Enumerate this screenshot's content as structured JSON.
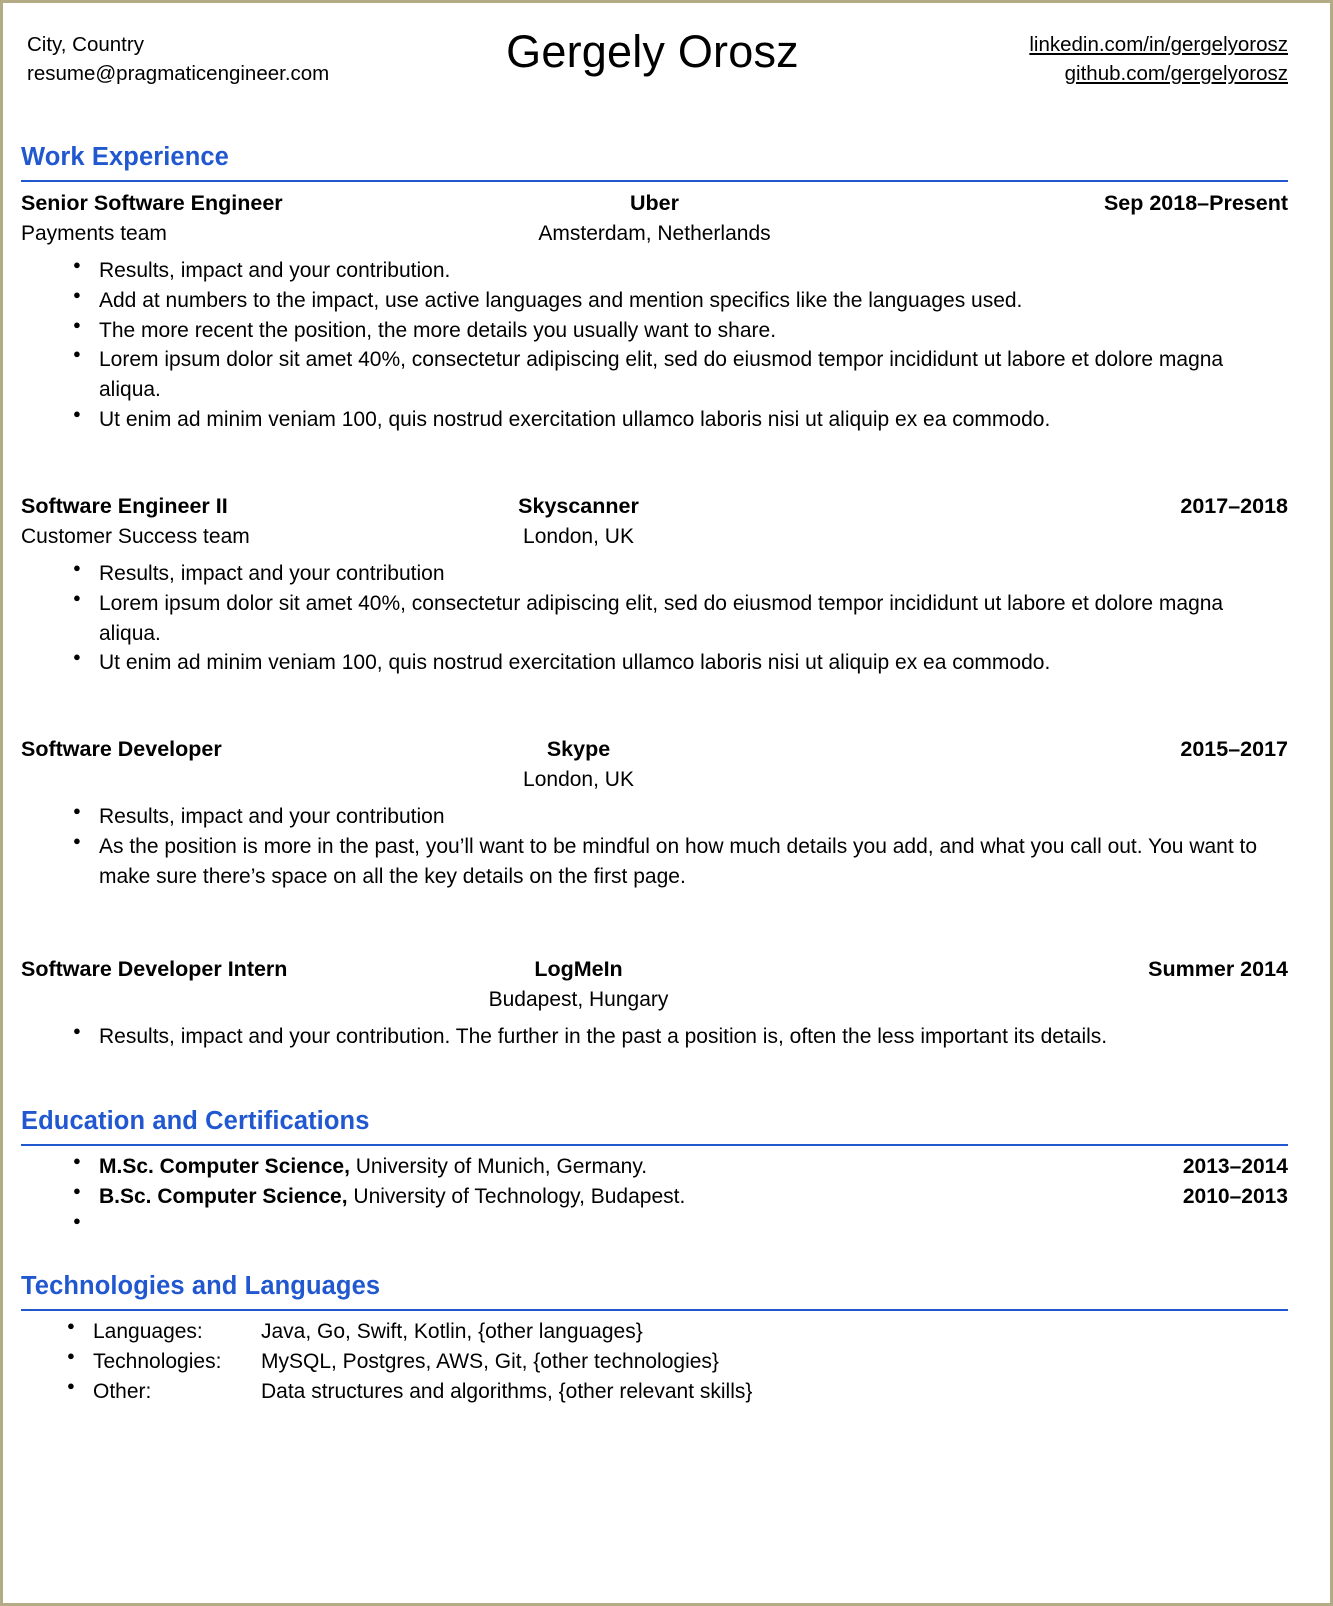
{
  "header": {
    "contact": {
      "location": "City, Country",
      "email": "resume@pragmaticengineer.com"
    },
    "name": "Gergely Orosz",
    "links": {
      "linkedin": "linkedin.com/in/gergelyorosz",
      "github": "github.com/gergelyorosz"
    }
  },
  "theme": {
    "accent": "#2158d0",
    "text": "#000000",
    "page_border": "#b3ab86"
  },
  "sections": {
    "work": {
      "title": "Work Experience",
      "jobs": [
        {
          "title": "Senior Software Engineer",
          "company": "Uber",
          "dates": "Sep 2018–Present",
          "team": "Payments team",
          "location": "Amsterdam, Netherlands",
          "bullets": [
            "Results, impact and your contribution.",
            "Add at numbers to the impact, use active languages and mention specifics like the languages used.",
            "The more recent the position, the more details you usually want to share.",
            "Lorem ipsum dolor sit amet 40%, consectetur adipiscing elit, sed do eiusmod tempor incididunt ut labore et dolore magna aliqua.",
            "Ut enim ad minim veniam 100, quis nostrud exercitation ullamco laboris nisi ut aliquip ex ea commodo."
          ]
        },
        {
          "title": "Software Engineer II",
          "company": "Skyscanner",
          "dates": "2017–2018",
          "team": "Customer Success team",
          "location": "London, UK",
          "bullets": [
            "Results, impact and your contribution",
            "Lorem ipsum dolor sit amet 40%, consectetur adipiscing elit, sed do eiusmod tempor incididunt ut labore et dolore magna aliqua.",
            "Ut enim ad minim veniam 100, quis nostrud exercitation ullamco laboris nisi ut aliquip ex ea commodo."
          ]
        },
        {
          "title": "Software Developer",
          "company": "Skype",
          "dates": "2015–2017",
          "team": "",
          "location": "London, UK",
          "bullets": [
            "Results, impact and your contribution",
            "As the position is more in the past, you’ll want to be mindful on how much details you add, and what you call out. You want to make sure there’s space on all the key details on the first page."
          ]
        },
        {
          "title": "Software Developer Intern",
          "company": "LogMeIn",
          "dates": "Summer 2014",
          "team": "",
          "location": "Budapest, Hungary",
          "bullets": [
            "Results, impact and your contribution. The further in the past a position is, often the less important its details."
          ]
        }
      ]
    },
    "education": {
      "title": "Education and Certifications",
      "items": [
        {
          "degree": "M.Sc. Computer Science,",
          "institution": " University of Munich, Germany.",
          "years": "2013–2014"
        },
        {
          "degree": "B.Sc. Computer Science,",
          "institution": " University of Technology, Budapest.",
          "years": "2010–2013"
        },
        {
          "degree": "",
          "institution": "",
          "years": ""
        }
      ]
    },
    "technologies": {
      "title": "Technologies and Languages",
      "rows": [
        {
          "label": "Languages:",
          "value": "Java, Go, Swift, Kotlin, {other languages}"
        },
        {
          "label": "Technologies:",
          "value": "MySQL, Postgres, AWS, Git, {other technologies}"
        },
        {
          "label": "Other:",
          "value": "Data structures and algorithms, {other relevant skills}"
        }
      ]
    }
  }
}
